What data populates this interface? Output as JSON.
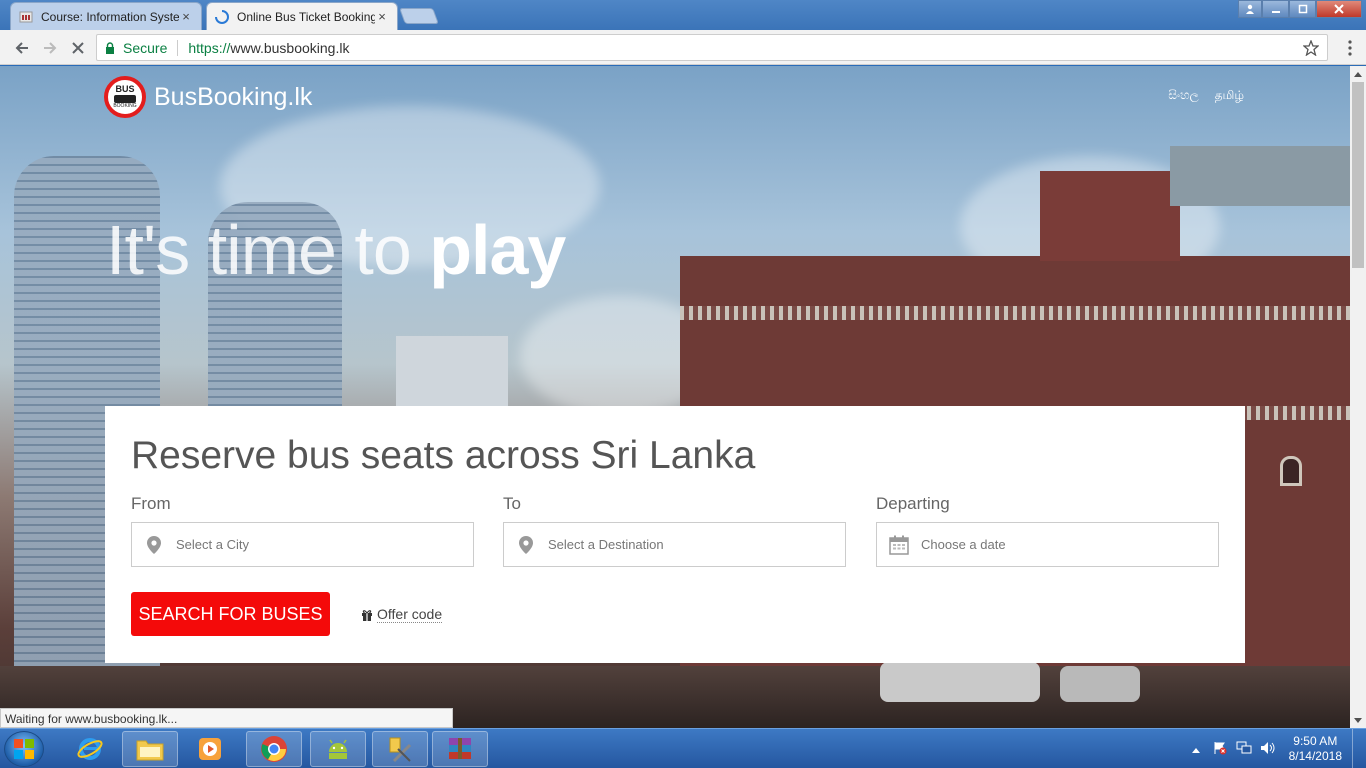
{
  "browser": {
    "tabs": [
      {
        "label": "Course: Information Syste",
        "active": false
      },
      {
        "label": "Online Bus Ticket Booking",
        "active": true
      }
    ],
    "close_glyph": "×",
    "address": {
      "secure_label": "Secure",
      "url_scheme": "https://",
      "url_host": "www.busbooking.lk"
    },
    "status_text": "Waiting for www.busbooking.lk..."
  },
  "site": {
    "logo_badge_top": "BUS",
    "logo_badge_bottom": "BOOKING",
    "logo_text": "BusBooking.lk",
    "languages": [
      "සිංහල",
      "தமிழ்"
    ],
    "hero_light": "It's time to ",
    "hero_bold": "play",
    "search": {
      "title": "Reserve bus seats across Sri Lanka",
      "from_label": "From",
      "from_placeholder": "Select a City",
      "to_label": "To",
      "to_placeholder": "Select a Destination",
      "date_label": "Departing",
      "date_placeholder": "Choose a date",
      "button_label": "SEARCH FOR BUSES",
      "offer_label": "Offer code"
    }
  },
  "taskbar": {
    "apps": [
      "windows-explorer",
      "internet-explorer",
      "windows-explorer-folder",
      "media-player",
      "chrome",
      "android-studio",
      "tools",
      "winrar"
    ],
    "clock_time": "9:50 AM",
    "clock_date": "8/14/2018"
  },
  "colors": {
    "brand_red": "#f40a0a",
    "secure_green": "#0b8043"
  }
}
